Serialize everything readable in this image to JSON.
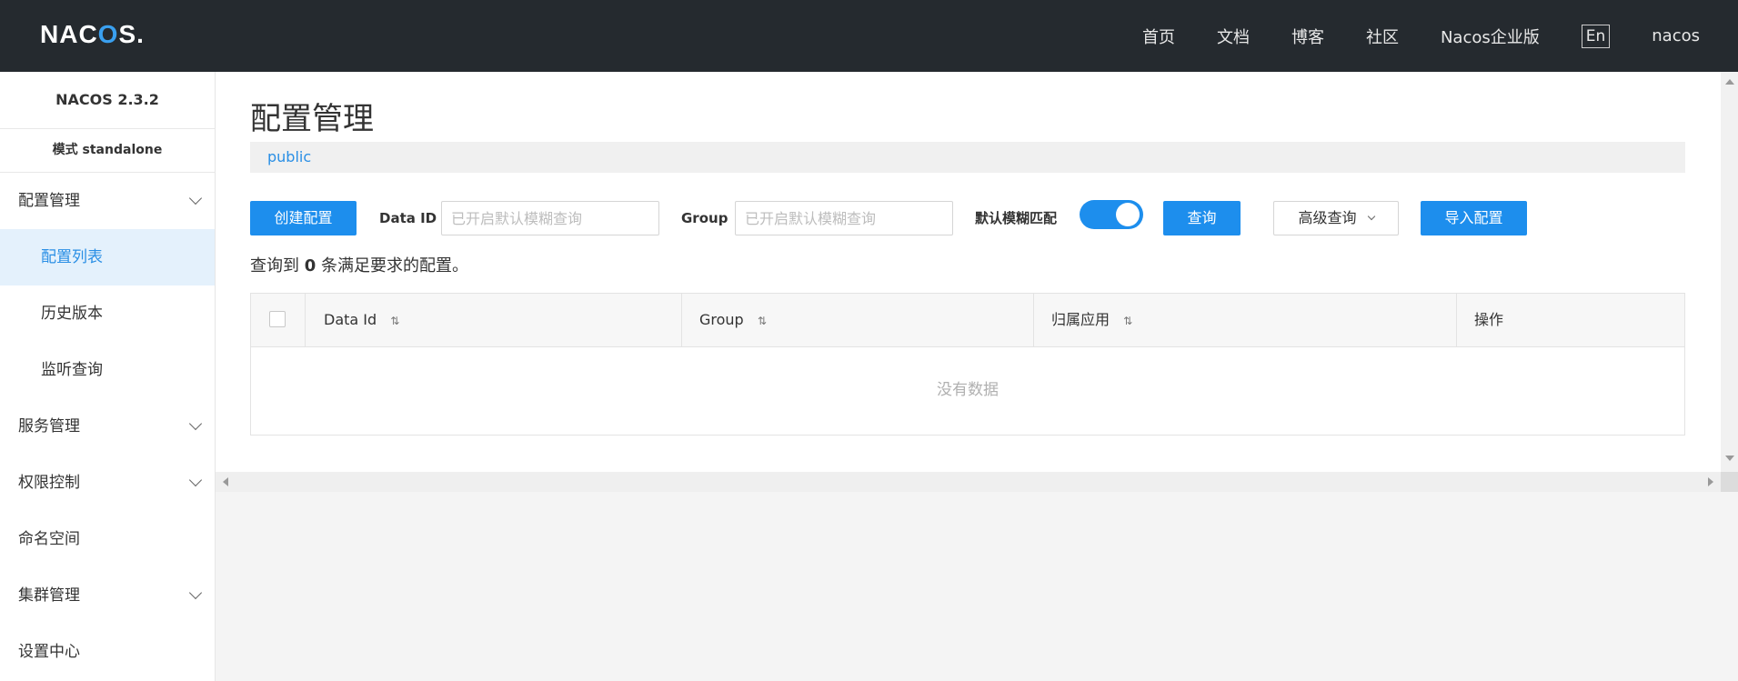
{
  "colors": {
    "topbar": "#252a2f",
    "accent": "#1d8eed",
    "sidebar_active_bg": "#e4f1fc",
    "sidebar_active_text": "#2a8fe5"
  },
  "header": {
    "logo_prefix": "NAC",
    "logo_o": "O",
    "logo_suffix": "S.",
    "nav": [
      "首页",
      "文档",
      "博客",
      "社区",
      "Nacos企业版"
    ],
    "lang": "En",
    "user": "nacos"
  },
  "sidebar": {
    "version": "NACOS 2.3.2",
    "mode": "模式 standalone",
    "groups": {
      "config": "配置管理",
      "config_items": [
        "配置列表",
        "历史版本",
        "监听查询"
      ],
      "service": "服务管理",
      "auth": "权限控制",
      "namespace": "命名空间",
      "cluster": "集群管理",
      "settings": "设置中心"
    }
  },
  "main": {
    "title": "配置管理",
    "namespace": "public",
    "create_btn": "创建配置",
    "data_id_label": "Data ID",
    "data_id_placeholder": "已开启默认模糊查询",
    "group_label": "Group",
    "group_placeholder": "已开启默认模糊查询",
    "fuzzy_label": "默认模糊匹配",
    "fuzzy_on": true,
    "query_btn": "查询",
    "advanced_btn": "高级查询",
    "advanced_icon": "chevron-down-icon",
    "import_btn": "导入配置",
    "result_prefix": "查询到",
    "result_count": "0",
    "result_suffix": "条满足要求的配置。"
  },
  "table": {
    "columns": [
      "Data Id",
      "Group",
      "归属应用",
      "操作"
    ],
    "sort_icon": "⇅",
    "empty": "没有数据"
  }
}
